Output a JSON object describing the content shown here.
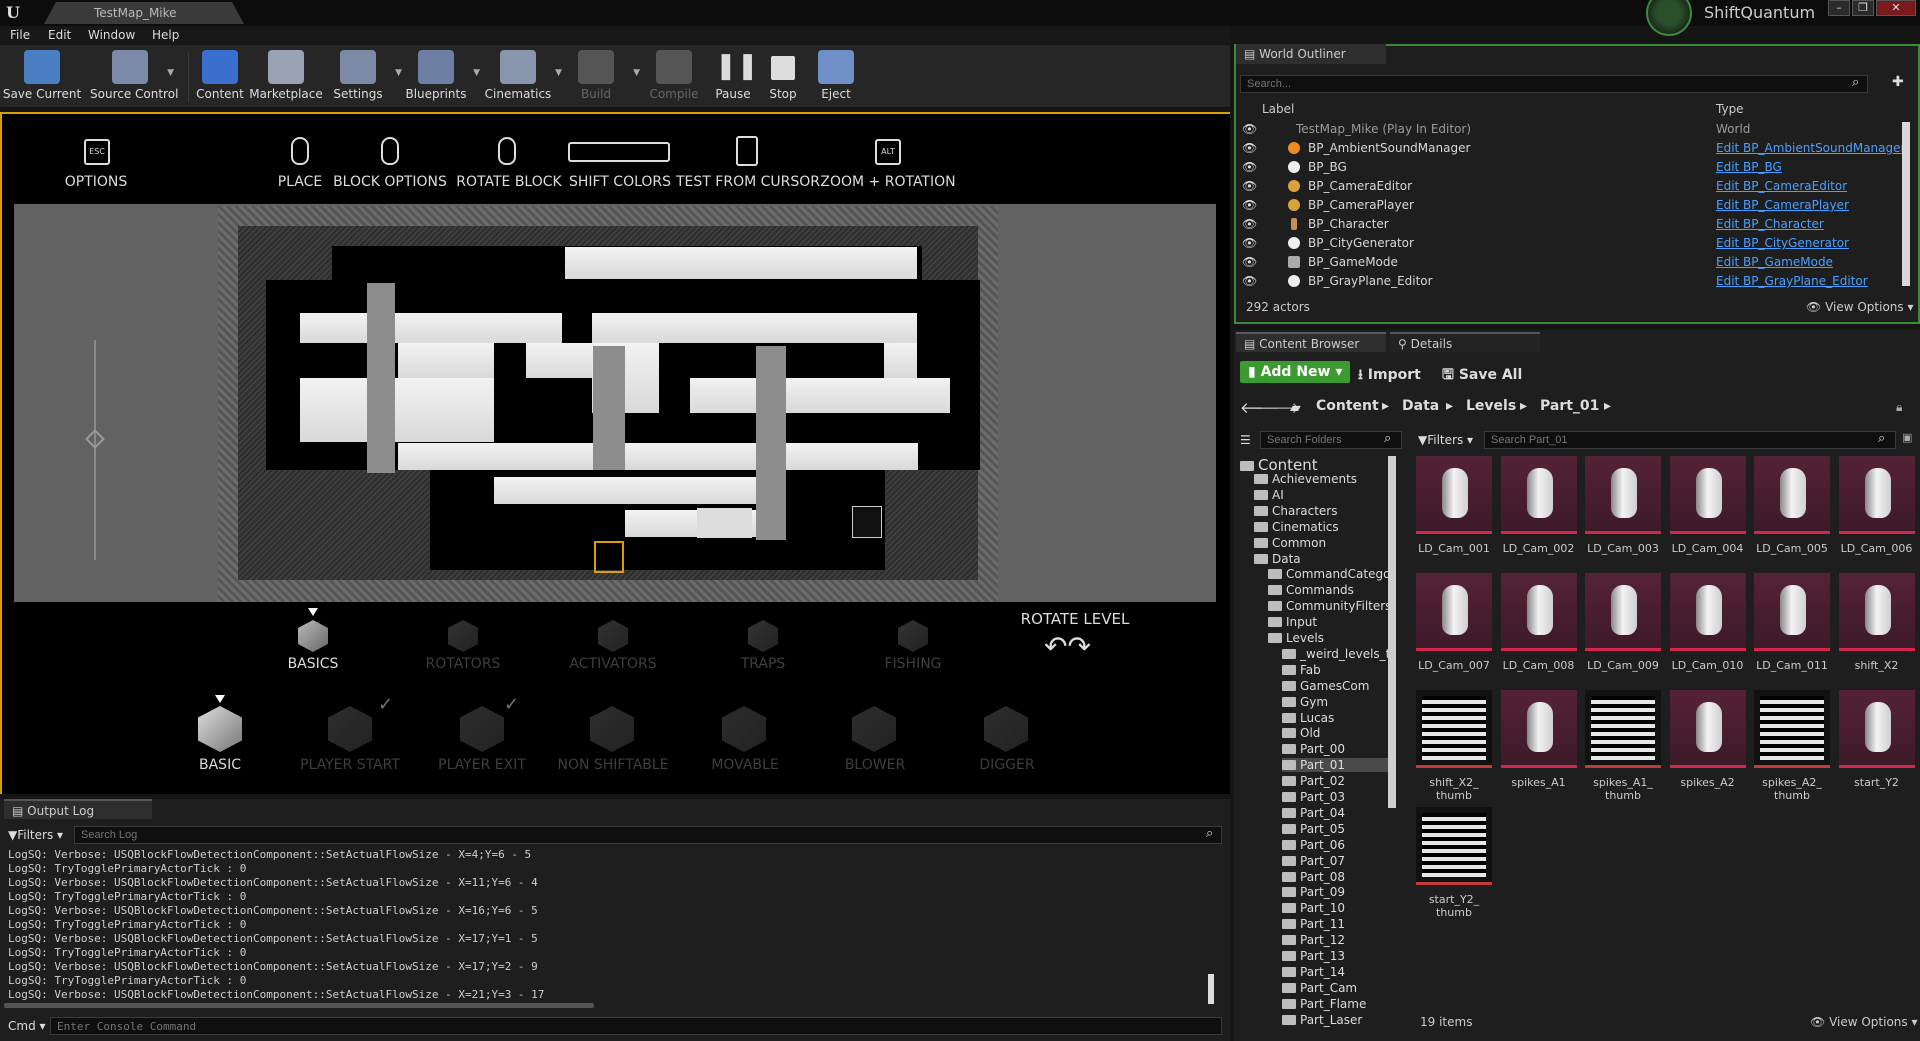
{
  "titlebar": {
    "map_tab": "TestMap_Mike",
    "brand": "ShiftQuantum"
  },
  "menu": [
    "File",
    "Edit",
    "Window",
    "Help"
  ],
  "toolbar": [
    {
      "label": "Save Current",
      "icon": "save-icon",
      "color": "#4a7fc1"
    },
    {
      "label": "Source Control",
      "icon": "source-control-icon",
      "color": "#7a8aa8"
    },
    {
      "label": "Content",
      "icon": "content-icon",
      "color": "#3a6fd0"
    },
    {
      "label": "Marketplace",
      "icon": "marketplace-icon",
      "color": "#9aa3b5"
    },
    {
      "label": "Settings",
      "icon": "settings-icon",
      "color": "#7b8aa5"
    },
    {
      "label": "Blueprints",
      "icon": "blueprints-icon",
      "color": "#6d7fa2"
    },
    {
      "label": "Cinematics",
      "icon": "cinematics-icon",
      "color": "#8a96ad"
    },
    {
      "label": "Build",
      "icon": "build-icon",
      "color": "#555"
    },
    {
      "label": "Compile",
      "icon": "compile-icon",
      "color": "#555"
    },
    {
      "label": "Pause",
      "icon": "pause-icon",
      "color": "#ccc"
    },
    {
      "label": "Stop",
      "icon": "stop-icon",
      "color": "#ddd"
    },
    {
      "label": "Eject",
      "icon": "eject-icon",
      "color": "#6f8fc6"
    }
  ],
  "viewport": {
    "hud_keys": [
      "ESC",
      "ALT"
    ],
    "hud_labels": [
      "OPTIONS",
      "PLACE",
      "BLOCK OPTIONS",
      "ROTATE BLOCK",
      "SHIFT COLORS",
      "TEST FROM CURSOR",
      "ZOOM + ROTATION"
    ],
    "categories": [
      "BASICS",
      "ROTATORS",
      "ACTIVATORS",
      "TRAPS",
      "FISHING"
    ],
    "rotate_level": "ROTATE LEVEL",
    "blocks": [
      "BASIC",
      "PLAYER START",
      "PLAYER EXIT",
      "NON SHIFTABLE",
      "MOVABLE",
      "BLOWER",
      "DIGGER"
    ]
  },
  "output_log": {
    "tab": "Output Log",
    "filters": "Filters",
    "search_placeholder": "Search Log",
    "lines": [
      "LogSQ: Verbose: USQBlockFlowDetectionComponent::SetActualFlowSize - X=4;Y=6 - 5",
      "LogSQ: TryTogglePrimaryActorTick : 0",
      "LogSQ: Verbose: USQBlockFlowDetectionComponent::SetActualFlowSize - X=11;Y=6 - 4",
      "LogSQ: TryTogglePrimaryActorTick : 0",
      "LogSQ: Verbose: USQBlockFlowDetectionComponent::SetActualFlowSize - X=16;Y=6 - 5",
      "LogSQ: TryTogglePrimaryActorTick : 0",
      "LogSQ: Verbose: USQBlockFlowDetectionComponent::SetActualFlowSize - X=17;Y=1 - 5",
      "LogSQ: TryTogglePrimaryActorTick : 0",
      "LogSQ: Verbose: USQBlockFlowDetectionComponent::SetActualFlowSize - X=17;Y=2 - 9",
      "LogSQ: TryTogglePrimaryActorTick : 0",
      "LogSQ: Verbose: USQBlockFlowDetectionComponent::SetActualFlowSize - X=21;Y=3 - 17"
    ],
    "cmd": "Cmd",
    "cmd_placeholder": "Enter Console Command"
  },
  "outliner": {
    "tab": "World Outliner",
    "search_placeholder": "Search...",
    "col_label": "Label",
    "col_type": "Type",
    "root": {
      "label": "TestMap_Mike (Play In Editor)",
      "type": "World"
    },
    "rows": [
      {
        "label": "BP_AmbientSoundManager",
        "type": "Edit BP_AmbientSoundManager"
      },
      {
        "label": "BP_BG",
        "type": "Edit BP_BG"
      },
      {
        "label": "BP_CameraEditor",
        "type": "Edit BP_CameraEditor"
      },
      {
        "label": "BP_CameraPlayer",
        "type": "Edit BP_CameraPlayer"
      },
      {
        "label": "BP_Character",
        "type": "Edit BP_Character"
      },
      {
        "label": "BP_CityGenerator",
        "type": "Edit BP_CityGenerator"
      },
      {
        "label": "BP_GameMode",
        "type": "Edit BP_GameMode"
      },
      {
        "label": "BP_GrayPlane_Editor",
        "type": "Edit BP_GrayPlane_Editor"
      }
    ],
    "count": "292 actors",
    "view_options": "View Options"
  },
  "content_browser": {
    "tab": "Content Browser",
    "details_tab": "Details",
    "add_new": "Add New",
    "import": "Import",
    "save_all": "Save All",
    "breadcrumb": [
      "Content",
      "Data",
      "Levels",
      "Part_01"
    ],
    "search_folders": "Search Folders",
    "filters": "Filters",
    "search_assets": "Search Part_01",
    "tree": [
      {
        "label": "Content",
        "indent": 0,
        "root": true
      },
      {
        "label": "Achievements",
        "indent": 1
      },
      {
        "label": "AI",
        "indent": 1
      },
      {
        "label": "Characters",
        "indent": 1
      },
      {
        "label": "Cinematics",
        "indent": 1
      },
      {
        "label": "Common",
        "indent": 1
      },
      {
        "label": "Data",
        "indent": 1
      },
      {
        "label": "CommandCatego",
        "indent": 2
      },
      {
        "label": "Commands",
        "indent": 2
      },
      {
        "label": "CommunityFilters",
        "indent": 2
      },
      {
        "label": "Input",
        "indent": 2
      },
      {
        "label": "Levels",
        "indent": 2
      },
      {
        "label": "_weird_levels_t",
        "indent": 3
      },
      {
        "label": "Fab",
        "indent": 3
      },
      {
        "label": "GamesCom",
        "indent": 3
      },
      {
        "label": "Gym",
        "indent": 3
      },
      {
        "label": "Lucas",
        "indent": 3
      },
      {
        "label": "Old",
        "indent": 3
      },
      {
        "label": "Part_00",
        "indent": 3
      },
      {
        "label": "Part_01",
        "indent": 3,
        "selected": true
      },
      {
        "label": "Part_02",
        "indent": 3
      },
      {
        "label": "Part_03",
        "indent": 3
      },
      {
        "label": "Part_04",
        "indent": 3
      },
      {
        "label": "Part_05",
        "indent": 3
      },
      {
        "label": "Part_06",
        "indent": 3
      },
      {
        "label": "Part_07",
        "indent": 3
      },
      {
        "label": "Part_08",
        "indent": 3
      },
      {
        "label": "Part_09",
        "indent": 3
      },
      {
        "label": "Part_10",
        "indent": 3
      },
      {
        "label": "Part_11",
        "indent": 3
      },
      {
        "label": "Part_12",
        "indent": 3
      },
      {
        "label": "Part_13",
        "indent": 3
      },
      {
        "label": "Part_14",
        "indent": 3
      },
      {
        "label": "Part_Cam",
        "indent": 3
      },
      {
        "label": "Part_Flame",
        "indent": 3
      },
      {
        "label": "Part_Laser",
        "indent": 3
      }
    ],
    "assets": [
      {
        "name": "LD_Cam_001",
        "kind": "mesh"
      },
      {
        "name": "LD_Cam_002",
        "kind": "mesh"
      },
      {
        "name": "LD_Cam_003",
        "kind": "mesh"
      },
      {
        "name": "LD_Cam_004",
        "kind": "mesh"
      },
      {
        "name": "LD_Cam_005",
        "kind": "mesh"
      },
      {
        "name": "LD_Cam_006",
        "kind": "mesh"
      },
      {
        "name": "LD_Cam_007",
        "kind": "mesh"
      },
      {
        "name": "LD_Cam_008",
        "kind": "mesh"
      },
      {
        "name": "LD_Cam_009",
        "kind": "mesh"
      },
      {
        "name": "LD_Cam_010",
        "kind": "mesh"
      },
      {
        "name": "LD_Cam_011",
        "kind": "mesh"
      },
      {
        "name": "shift_X2",
        "kind": "mesh"
      },
      {
        "name": "shift_X2_ thumb",
        "kind": "tex"
      },
      {
        "name": "spikes_A1",
        "kind": "mesh"
      },
      {
        "name": "spikes_A1_ thumb",
        "kind": "tex"
      },
      {
        "name": "spikes_A2",
        "kind": "mesh"
      },
      {
        "name": "spikes_A2_ thumb",
        "kind": "tex"
      },
      {
        "name": "start_Y2",
        "kind": "mesh"
      },
      {
        "name": "start_Y2_ thumb",
        "kind": "tex"
      }
    ],
    "count": "19 items",
    "view_options": "View Options"
  }
}
